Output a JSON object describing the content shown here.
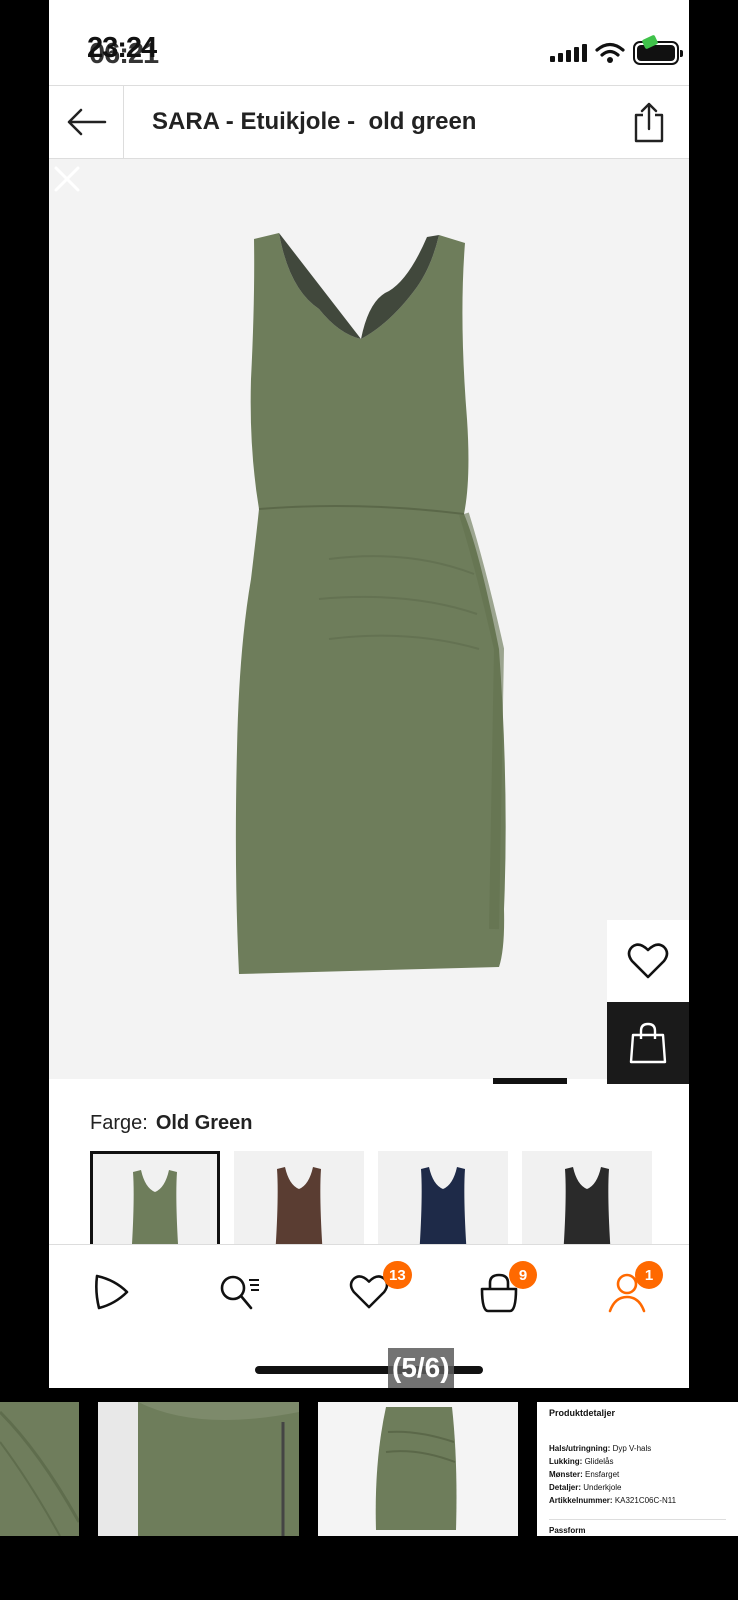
{
  "status_bar": {
    "time": "06:21",
    "time_overlap": "23:24"
  },
  "header": {
    "title": "SARA - Etuikjole -  old green"
  },
  "product": {
    "color_label": "Farge:",
    "color_value": "Old Green"
  },
  "swatches": [
    {
      "name": "Old Green",
      "color": "#6e7d5b",
      "selected": true
    },
    {
      "name": "Brown",
      "color": "#5a3d32",
      "selected": false
    },
    {
      "name": "Navy",
      "color": "#1e2a48",
      "selected": false
    },
    {
      "name": "Black",
      "color": "#2a2a2a",
      "selected": false
    }
  ],
  "tabbar": {
    "wishlist_badge": "13",
    "bag_badge": "9",
    "profile_badge": "1"
  },
  "image_counter": "(5/6)",
  "details_panel": {
    "heading": "Produktdetaljer",
    "rows": [
      {
        "key": "Hals/utringning:",
        "value": "Dyp V-hals"
      },
      {
        "key": "Lukking:",
        "value": "Glidelås"
      },
      {
        "key": "Mønster:",
        "value": "Ensfarget"
      },
      {
        "key": "Detaljer:",
        "value": "Underkjole"
      },
      {
        "key": "Artikkelnummer:",
        "value": "KA321C06C-N11"
      }
    ],
    "footer": "Passform"
  },
  "colors": {
    "accent": "#ff6900",
    "dress": "#6e7d5b"
  }
}
